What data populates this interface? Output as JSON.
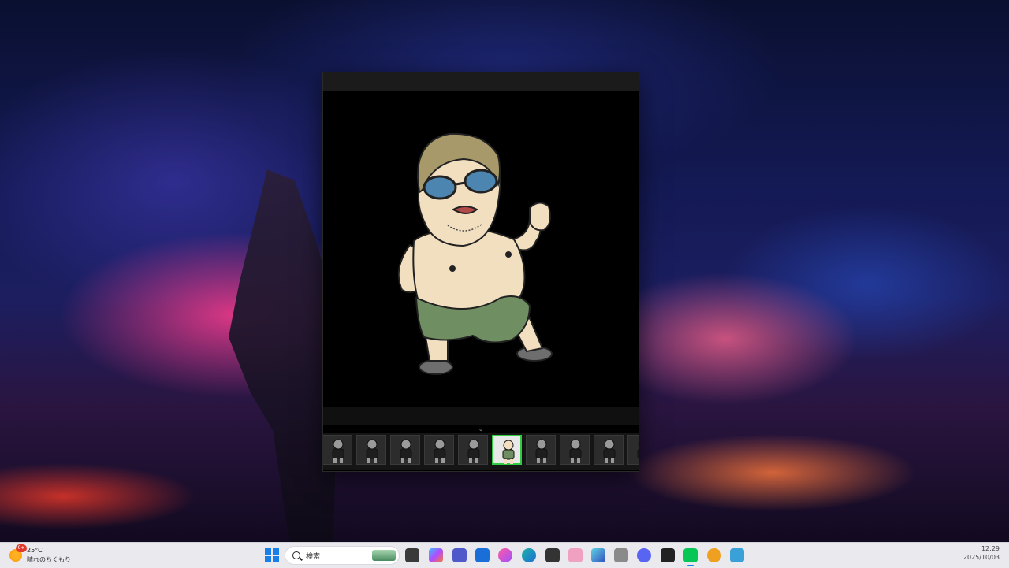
{
  "taskbar": {
    "weather": {
      "badge": "9+",
      "temperature": "25°C",
      "description": "晴れのちくもり"
    },
    "search": {
      "placeholder": "検索"
    },
    "clock": {
      "time": "12:29",
      "date": "2025/10/03"
    }
  },
  "viewer": {
    "filmstrip": {
      "thumbnail_count": 10,
      "selected_index": 5
    }
  },
  "colors": {
    "accent": "#1a7ee8",
    "filmstrip_selection": "#2ecc40",
    "taskbar_bg": "#e9e9ee"
  },
  "taskbar_icons": [
    "windows-start-icon",
    "search-icon",
    "task-view-icon",
    "copilot-icon",
    "teams-icon",
    "store-icon",
    "itunes-icon",
    "edge-icon",
    "app-icon",
    "app-icon",
    "app-icon",
    "volume-icon",
    "discord-icon",
    "netflix-icon",
    "line-icon",
    "coin-app-icon",
    "notepad-icon"
  ]
}
